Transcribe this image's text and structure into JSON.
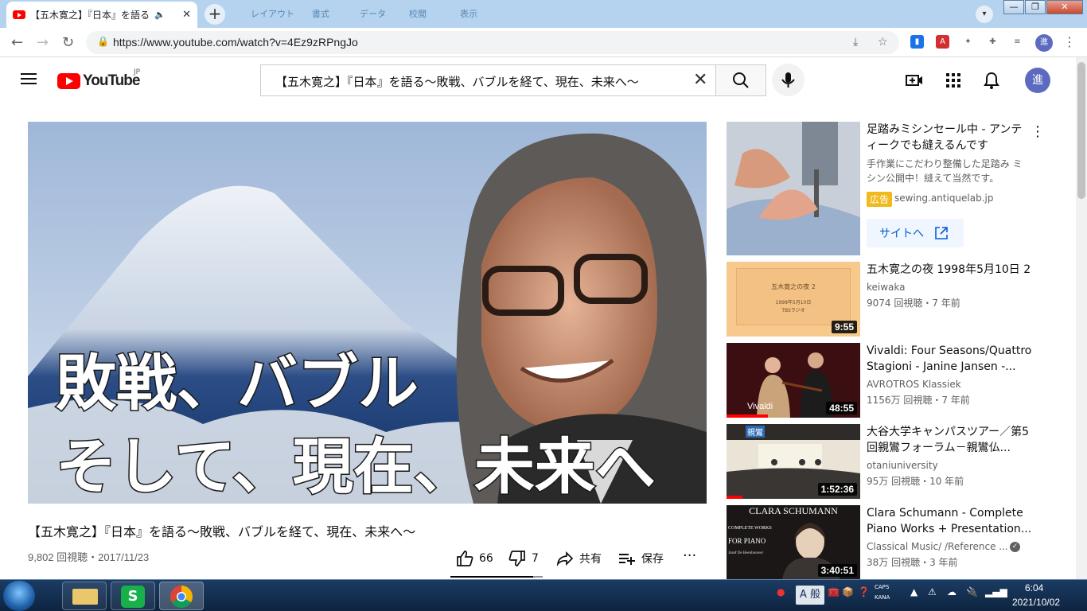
{
  "browser": {
    "tab_title": "【五木寛之】『日本』を語る〜敗戦",
    "ghost_tabs": [
      "レイアウト",
      "書式",
      "データ",
      "校閲",
      "表示"
    ],
    "url": "https://www.youtube.com/watch?v=4Ez9zRPngJo",
    "profile_initial": "進"
  },
  "youtube": {
    "logo_text": "YouTube",
    "region": "JP",
    "search_value": "【五木寛之】『日本』を語る〜敗戦、バブルを経て、現在、未来へ〜",
    "avatar_initial": "進"
  },
  "player": {
    "overlay_line1": "敗戦、バブル",
    "overlay_line2": "そして、現在、未来へ"
  },
  "video": {
    "title": "【五木寛之】『日本』を語る〜敗戦、バブルを経て、現在、未来へ〜",
    "meta": "9,802 回視聴・2017/11/23",
    "likes": "66",
    "dislikes": "7",
    "share": "共有",
    "save": "保存",
    "like_ratio": 0.9
  },
  "sidebar": {
    "ad": {
      "title": "足踏みミシンセール中 - アンティークでも縫えるんです",
      "desc": "手作業にこだわり整備した足踏み ミシン公開中！縫えて当然です。",
      "badge": "広告",
      "domain": "sewing.antiquelab.jp",
      "cta": "サイトへ"
    },
    "items": [
      {
        "title": "五木寛之の夜 1998年5月10日 2",
        "channel": "keiwaka",
        "views": "9074 回視聴・7 年前",
        "duration": "9:55",
        "thumb_title": "五木寛之の夜 2",
        "thumb_sub1": "1998年5月10日",
        "thumb_sub2": "TBSラジオ"
      },
      {
        "title": "Vivaldi: Four Seasons/Quattro Stagioni - Janine Jansen -...",
        "channel": "AVROTROS Klassiek",
        "views": "1156万 回視聴・7 年前",
        "duration": "48:55",
        "thumb_label": "Vivaldi"
      },
      {
        "title": "大谷大学キャンパスツアー／第5回親鸞フォーラム－親鸞仏...",
        "channel": "otaniuniversity",
        "views": "95万 回視聴・10 年前",
        "duration": "1:52:36",
        "thumb_label": "親鸞"
      },
      {
        "title": "Clara Schumann - Complete Piano Works + Presentation...",
        "channel": "Classical Music/ /Reference ...",
        "views": "38万 回視聴・3 年前",
        "duration": "3:40:51",
        "thumb_title": "CLARA SCHUMANN",
        "thumb_sub1": "COMPLETE WORKS",
        "thumb_sub2": "FOR PIANO",
        "thumb_sub3": "Jozef De Beenhouwer"
      }
    ]
  },
  "taskbar": {
    "ime": "A 般",
    "caps": "CAPS",
    "kana": "KANA",
    "time": "6:04",
    "date": "2021/10/02"
  },
  "icons": [
    "youtube-favicon",
    "speaker-icon",
    "close-icon",
    "plus-icon",
    "back-icon",
    "forward-icon",
    "reload-icon",
    "lock-icon",
    "install-icon",
    "star-icon",
    "menu-icon",
    "search-icon",
    "mic-icon",
    "create-icon",
    "apps-icon",
    "bell-icon",
    "like-icon",
    "dislike-icon",
    "share-icon",
    "save-icon",
    "more-icon",
    "external-link-icon",
    "verified-icon"
  ]
}
